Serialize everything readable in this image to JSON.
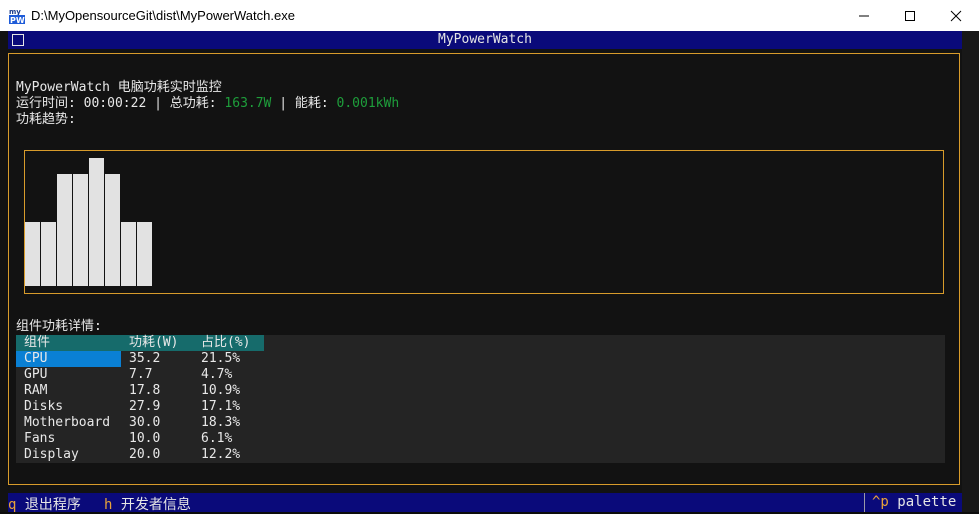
{
  "window": {
    "title": "D:\\MyOpensourceGit\\dist\\MyPowerWatch.exe",
    "icon_name": "app-icon"
  },
  "terminal": {
    "header_title": "MyPowerWatch",
    "app_heading": "MyPowerWatch 电脑功耗实时监控",
    "runtime_label": "运行时间:",
    "runtime_value": "00:00:22",
    "power_label": "总功耗:",
    "power_value": "163.7W",
    "energy_label": "能耗:",
    "energy_value": "0.001kWh",
    "trend_label": "功耗趋势:",
    "separator": "|",
    "accent_color": "#d79b2b",
    "value_color": "#1e9e3b"
  },
  "chart_data": {
    "type": "bar",
    "title": "",
    "values": [
      4,
      4,
      7,
      7,
      8,
      7,
      4,
      4
    ],
    "ylim": [
      0,
      8
    ]
  },
  "components": {
    "title": "组件功耗详情:",
    "headers": [
      "组件",
      "功耗(W)",
      "占比(%)"
    ],
    "rows": [
      [
        "CPU",
        "35.2",
        "21.5%"
      ],
      [
        "GPU",
        "7.7",
        "4.7%"
      ],
      [
        "RAM",
        "17.8",
        "10.9%"
      ],
      [
        "Disks",
        "27.9",
        "17.1%"
      ],
      [
        "Motherboard",
        "30.0",
        "18.3%"
      ],
      [
        "Fans",
        "10.0",
        "6.1%"
      ],
      [
        "Display",
        "20.0",
        "12.2%"
      ]
    ],
    "selected_index": 0
  },
  "footer": {
    "quit_key": "q",
    "quit_label": "退出程序",
    "dev_key": "h",
    "dev_label": "开发者信息",
    "palette_key": "^p",
    "palette_label": "palette"
  }
}
